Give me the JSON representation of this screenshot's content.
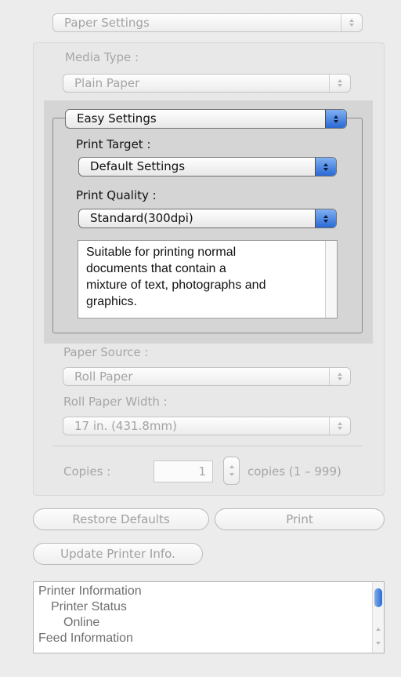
{
  "top_popup": {
    "value": "Paper Settings"
  },
  "media_type": {
    "label": "Media Type :",
    "value": "Plain Paper"
  },
  "easy_settings": {
    "value": "Easy Settings",
    "print_target_label": "Print Target :",
    "print_target_value": "Default Settings",
    "print_quality_label": "Print Quality :",
    "print_quality_value": "Standard(300dpi)",
    "description_lines": [
      "Suitable for printing normal",
      "documents that contain a",
      "mixture of text, photographs and",
      "graphics."
    ]
  },
  "paper_source": {
    "label": "Paper Source :",
    "value": "Roll Paper"
  },
  "roll_paper_width": {
    "label": "Roll Paper Width :",
    "value": "17 in. (431.8mm)"
  },
  "copies": {
    "label": "Copies :",
    "value": "1",
    "range": "copies (1 – 999)"
  },
  "buttons": {
    "restore_defaults": "Restore Defaults",
    "print": "Print",
    "update_printer_info": "Update Printer Info."
  },
  "info_list": {
    "items": [
      "Printer Information",
      "Printer Status",
      "Online",
      "Feed Information"
    ]
  },
  "colors": {
    "accent": "#2a69d4",
    "group_bg": "#d6d6d6"
  }
}
